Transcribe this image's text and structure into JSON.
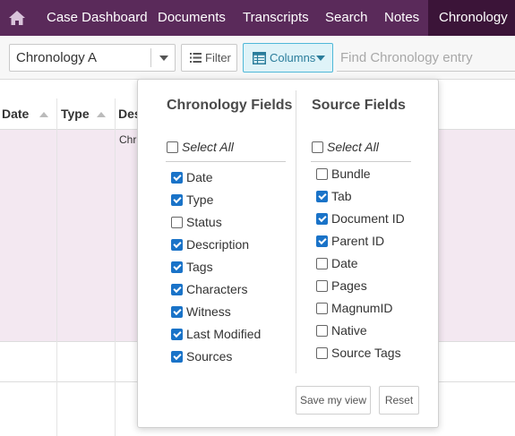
{
  "nav": {
    "items": [
      {
        "label": "Case Dashboard"
      },
      {
        "label": "Documents"
      },
      {
        "label": "Transcripts"
      },
      {
        "label": "Search"
      },
      {
        "label": "Notes"
      },
      {
        "label": "Chronology",
        "active": true
      }
    ]
  },
  "toolbar": {
    "chronology_select": "Chronology A",
    "filter_label": "Filter",
    "columns_label": "Columns",
    "find_placeholder": "Find Chronology entry"
  },
  "table": {
    "headers": [
      "Date",
      "Type",
      "Des"
    ],
    "first_cell": "Chr"
  },
  "columns_panel": {
    "chronology_title": "Chronology Fields",
    "source_title": "Source Fields",
    "select_all_label": "Select All",
    "chronology_fields": [
      {
        "label": "Date",
        "checked": true
      },
      {
        "label": "Type",
        "checked": true
      },
      {
        "label": "Status",
        "checked": false
      },
      {
        "label": "Description",
        "checked": true
      },
      {
        "label": "Tags",
        "checked": true
      },
      {
        "label": "Characters",
        "checked": true
      },
      {
        "label": "Witness",
        "checked": true
      },
      {
        "label": "Last Modified",
        "checked": true
      },
      {
        "label": "Sources",
        "checked": true
      }
    ],
    "source_fields": [
      {
        "label": "Bundle",
        "checked": false
      },
      {
        "label": "Tab",
        "checked": true
      },
      {
        "label": "Document ID",
        "checked": true
      },
      {
        "label": "Parent ID",
        "checked": true
      },
      {
        "label": "Date",
        "checked": false
      },
      {
        "label": "Pages",
        "checked": false
      },
      {
        "label": "MagnumID",
        "checked": false
      },
      {
        "label": "Native",
        "checked": false
      },
      {
        "label": "Source Tags",
        "checked": false
      }
    ],
    "save_label": "Save my view",
    "reset_label": "Reset"
  },
  "colors": {
    "nav_bg": "#5a2a5a",
    "nav_active": "#3b1438",
    "accent": "#4fb8d8",
    "checkbox": "#1a73c8",
    "row_highlight": "#f3e8f1"
  }
}
